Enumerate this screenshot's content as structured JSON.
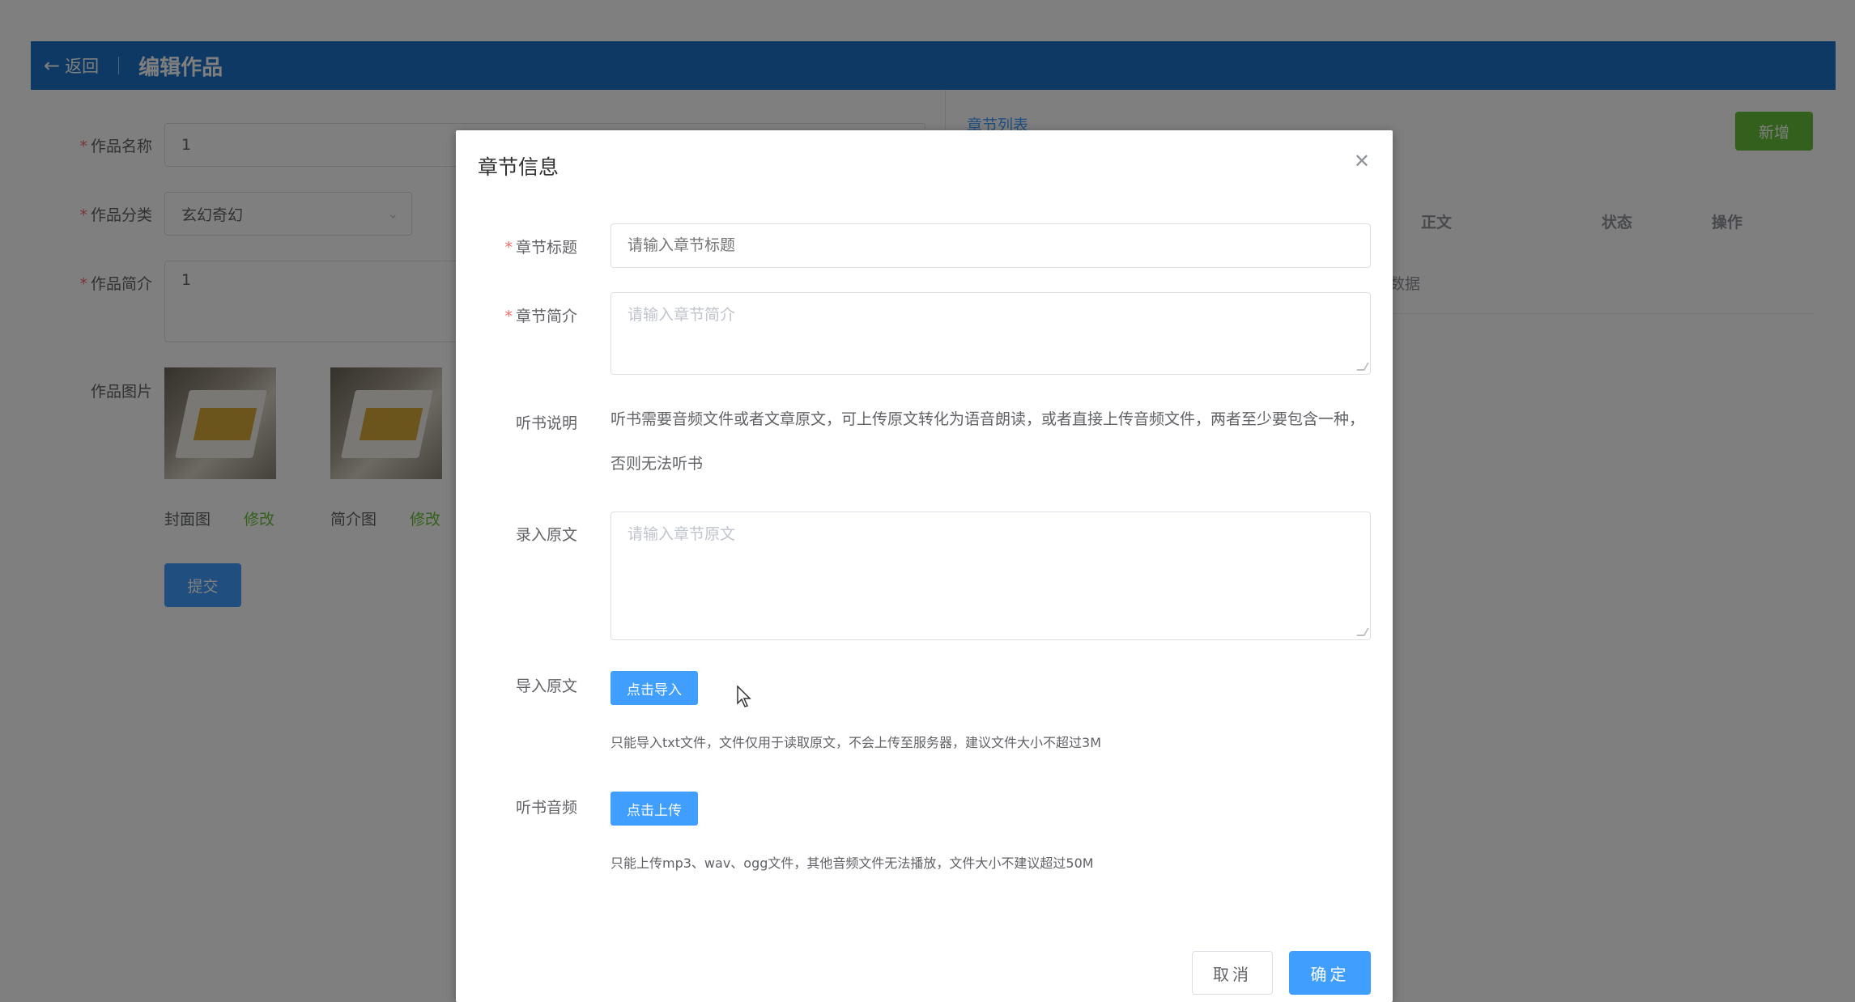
{
  "header": {
    "back_label": "返回",
    "title": "编辑作品"
  },
  "work_form": {
    "name_label": "作品名称",
    "name_value": "1",
    "category_label": "作品分类",
    "category_value": "玄幻奇幻",
    "intro_label": "作品简介",
    "intro_value": "1",
    "image_label": "作品图片",
    "cover_caption": "封面图",
    "cover_edit": "修改",
    "intro_img_caption": "简介图",
    "intro_img_edit": "修改",
    "submit_label": "提交"
  },
  "chapter_panel": {
    "list_link": "章节列表",
    "add_label": "新增",
    "columns": [
      "正文",
      "状态",
      "操作"
    ],
    "empty_text": "数据"
  },
  "dialog": {
    "title": "章节信息",
    "chapter_title_label": "章节标题",
    "chapter_title_placeholder": "请输入章节标题",
    "chapter_intro_label": "章节简介",
    "chapter_intro_placeholder": "请输入章节简介",
    "audio_desc_label": "听书说明",
    "audio_desc_text": "听书需要音频文件或者文章原文，可上传原文转化为语音朗读，或者直接上传音频文件，两者至少要包含一种，否则无法听书",
    "raw_text_label": "录入原文",
    "raw_text_placeholder": "请输入章节原文",
    "import_label": "导入原文",
    "import_button": "点击导入",
    "import_tip": "只能导入txt文件，文件仅用于读取原文，不会上传至服务器，建议文件大小不超过3M",
    "audio_label": "听书音频",
    "upload_button": "点击上传",
    "upload_tip": "只能上传mp3、wav、ogg文件，其他音频文件无法播放，文件大小不建议超过50M",
    "cancel_label": "取消",
    "confirm_label": "确定"
  }
}
